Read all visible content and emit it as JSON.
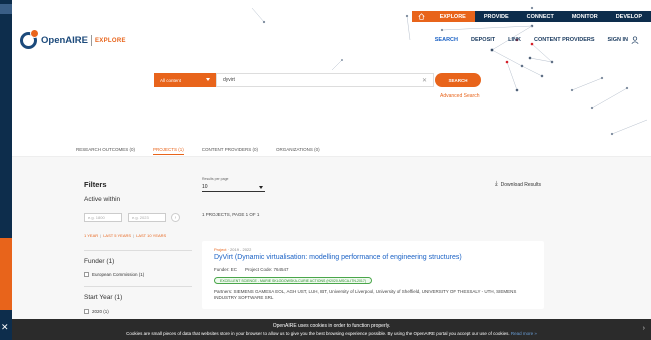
{
  "topnav": {
    "items": [
      {
        "label": "EXPLORE",
        "active": true
      },
      {
        "label": "PROVIDE",
        "active": false
      },
      {
        "label": "CONNECT",
        "active": false
      },
      {
        "label": "MONITOR",
        "active": false
      },
      {
        "label": "DEVELOP",
        "active": false
      }
    ]
  },
  "brand": {
    "name": "OpenAIRE",
    "section": "EXPLORE"
  },
  "mainnav": {
    "items": [
      {
        "label": "SEARCH",
        "active": true
      },
      {
        "label": "DEPOSIT",
        "active": false
      },
      {
        "label": "LINK",
        "active": false
      },
      {
        "label": "CONTENT PROVIDERS",
        "active": false
      }
    ],
    "signin": "SIGN IN"
  },
  "search": {
    "category": "All content",
    "query": "dyvirt",
    "button": "SEARCH",
    "advanced": "Advanced Search"
  },
  "tabs": [
    {
      "label": "RESEARCH OUTCOMES (0)",
      "active": false
    },
    {
      "label": "PROJECTS (1)",
      "active": true
    },
    {
      "label": "CONTENT PROVIDERS (0)",
      "active": false
    },
    {
      "label": "ORGANIZATIONS (0)",
      "active": false
    }
  ],
  "filters": {
    "title": "Filters",
    "active_within": "Active within",
    "year_from_placeholder": "e.g. 1800",
    "year_to_placeholder": "e.g. 2023",
    "quick": [
      "1 YEAR",
      "LAST 5 YEARS",
      "LAST 10 YEARS"
    ],
    "funder_title": "Funder (1)",
    "funder_option": "European Commission (1)",
    "startyear_title": "Start Year (1)",
    "startyear_option": "2020 (1)"
  },
  "results": {
    "per_page_label": "Results per page",
    "per_page": "10",
    "download": "Download Results",
    "count": "1 PROJECTS, PAGE 1 OF 1"
  },
  "result": {
    "type": "Project",
    "years": "2019 - 2022",
    "title": "DyVirt (Dynamic virtualisation: modelling performance of engineering structures)",
    "funder": "Funder: EC",
    "project_code": "Project Code: 764547",
    "programme": "EXCELLENT SCIENCE - MARIE SKLODOWSKA-CURIE ACTIONS (H2020-MSCA-ITN-2017)",
    "partners": "Partners: SIEMENS GAMESA EOL, AGH UST, LUH, IBT, University of Liverpool, University of Sheffield, UNIVERSITY OF THESSALY - UTH, SIEMENS INDUSTRY SOFTWARE SRL"
  },
  "cookie": {
    "line1": "OpenAIRE uses cookies in order to function properly.",
    "line2": "Cookies are small pieces of data that websites store in your browser to allow us to give you the best browsing experience possible. By using the OpenAIRE portal you accept our use of cookies.",
    "more": "Read more »"
  },
  "colors": {
    "accent": "#e8641b",
    "navy": "#0d2d4c",
    "link": "#1b62c5"
  }
}
